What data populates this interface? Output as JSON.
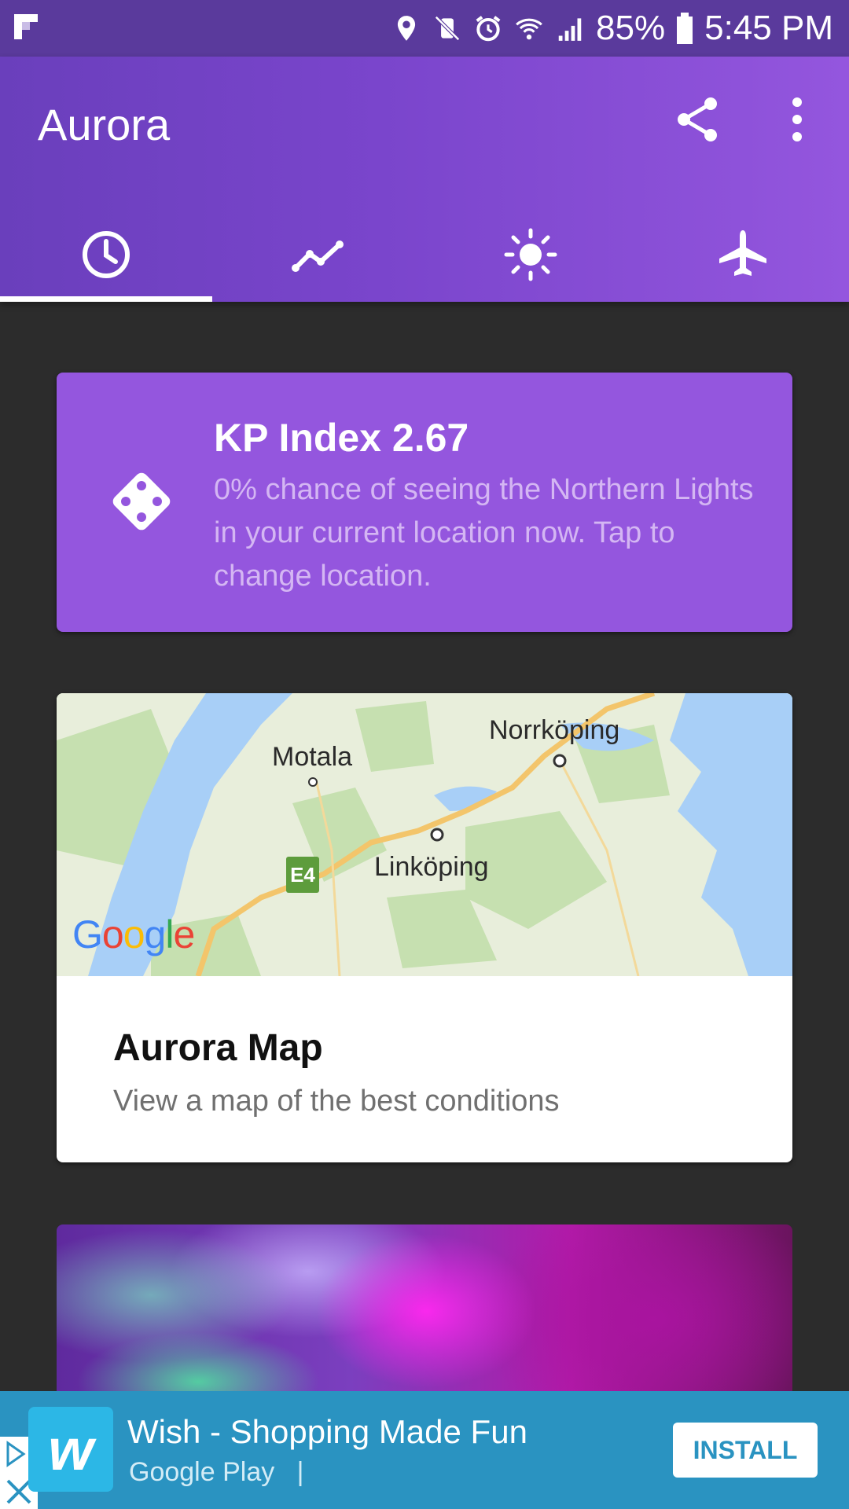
{
  "status_bar": {
    "battery": "85%",
    "time": "5:45 PM"
  },
  "app_bar": {
    "title": "Aurora",
    "tabs": [
      {
        "icon": "clock-icon",
        "active": true
      },
      {
        "icon": "trend-chart-icon",
        "active": false
      },
      {
        "icon": "sun-icon",
        "active": false
      },
      {
        "icon": "airplane-icon",
        "active": false
      }
    ]
  },
  "kp_card": {
    "title": "KP Index 2.67",
    "description": "0% chance of seeing the Northern Lights in your current location now. Tap to change location."
  },
  "map_card": {
    "places": [
      "Motala",
      "Norrköping",
      "Linköping"
    ],
    "road_badge": "E4",
    "google_logo": "Google",
    "title": "Aurora Map",
    "subtitle": "View a map of the best conditions"
  },
  "ad": {
    "app_name": "Wish - Shopping Made Fun",
    "store": "Google Play",
    "install_label": "INSTALL"
  },
  "colors": {
    "accent": "#9456de",
    "status_bar": "#5a3a9c",
    "ad_background": "#2a93c1"
  }
}
